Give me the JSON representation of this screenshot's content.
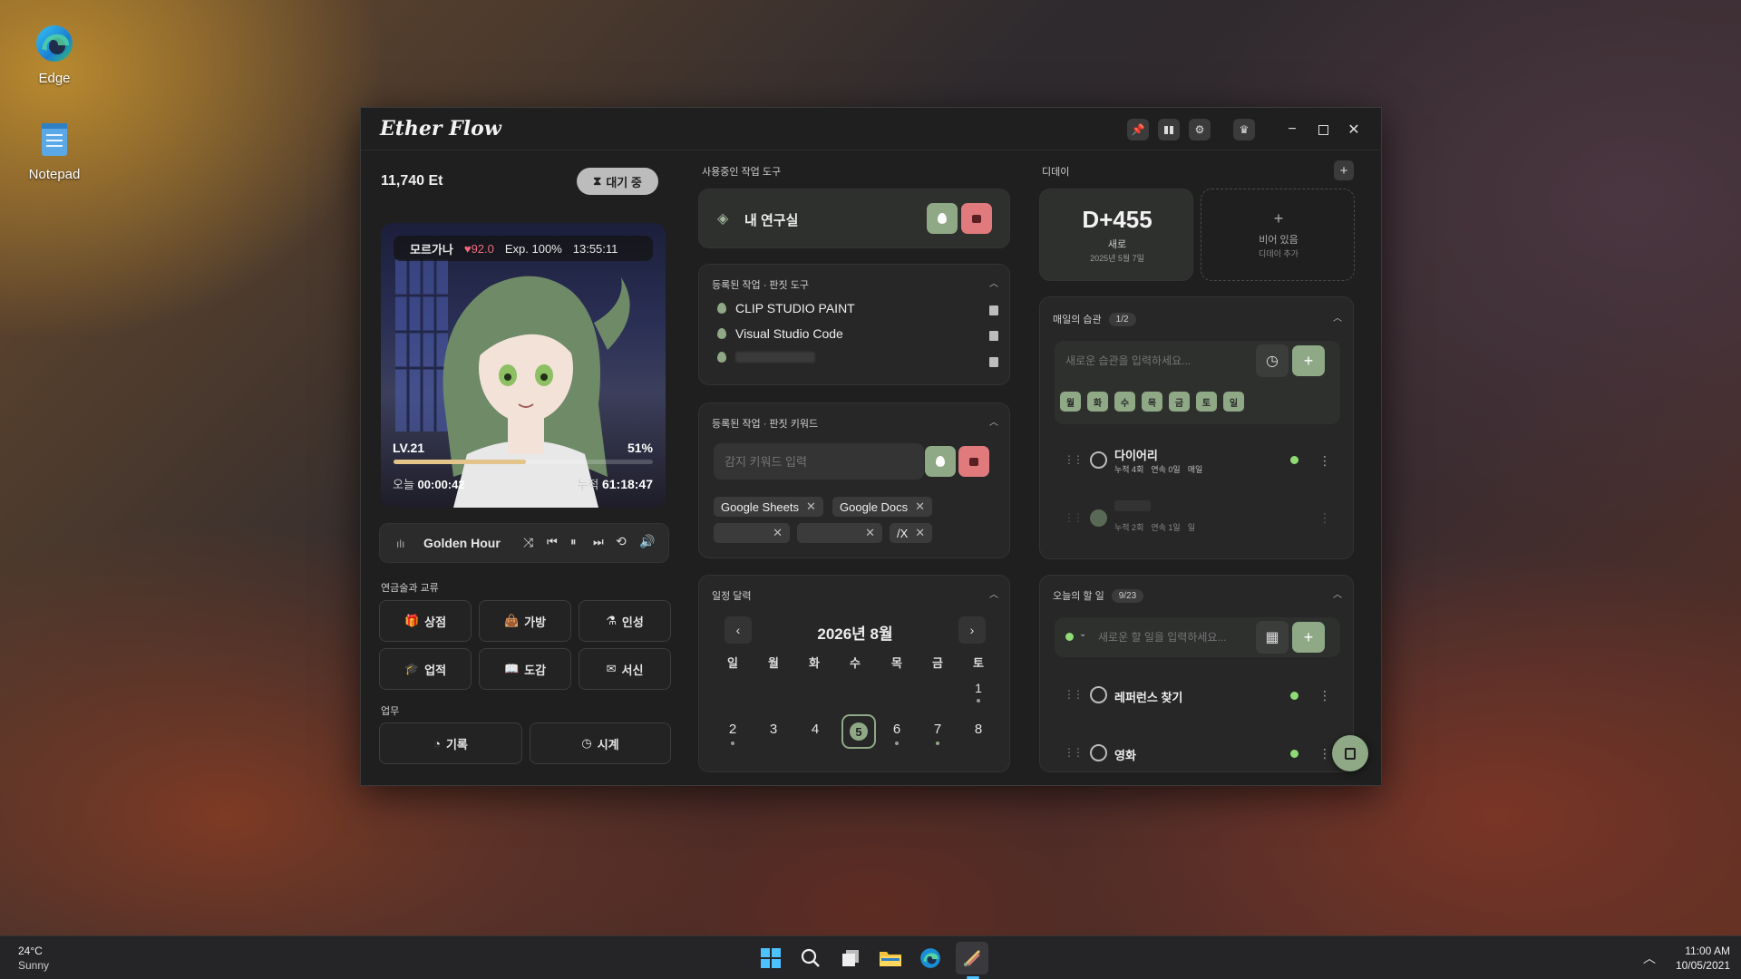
{
  "desktop": {
    "icons": [
      {
        "label": "Edge",
        "icon": "edge-icon"
      },
      {
        "label": "Notepad",
        "icon": "notepad-icon"
      }
    ]
  },
  "window": {
    "title": "Ether Flow",
    "toolbar_icons": [
      "pin-icon",
      "columns-icon",
      "settings-icon",
      "crown-icon",
      "minimize-icon",
      "maximize-icon",
      "close-icon"
    ]
  },
  "left": {
    "currency": "11,740 Et",
    "status_button": "대기 중",
    "character": {
      "name": "모르가나",
      "affection": "92.0",
      "exp": "Exp. 100%",
      "time": "13:55:11",
      "level": "LV.21",
      "level_percent": "51%",
      "level_progress": 0.51,
      "today_label": "오늘",
      "today_time": "00:00:42",
      "total_label": "누적",
      "total_time": "61:18:47"
    },
    "player": {
      "track": "Golden Hour"
    },
    "section_growth": "연금술과 교류",
    "growth_buttons": [
      "상점",
      "가방",
      "인성",
      "업적",
      "도감",
      "서신"
    ],
    "section_work": "업무",
    "work_buttons": [
      "기록",
      "시계"
    ]
  },
  "middle": {
    "active_tool_title": "사용중인 작업 도구",
    "active_tool": "내 연구실",
    "tools_title": "등록된 작업 · 판짓 도구",
    "tools": [
      "CLIP STUDIO PAINT",
      "Visual Studio Code",
      ""
    ],
    "keywords_title": "등록된 작업 · 판짓 키워드",
    "keyword_placeholder": "감지 키워드 입력",
    "keywords": [
      "Google Sheets",
      "Google Docs",
      "",
      "",
      "/X"
    ],
    "calendar_title": "일정 달력",
    "calendar_month": "2026년 8월",
    "weekdays": [
      "일",
      "월",
      "화",
      "수",
      "목",
      "금",
      "토"
    ],
    "week1": [
      "",
      "",
      "",
      "",
      "",
      "",
      "1"
    ],
    "week2": [
      "2",
      "3",
      "4",
      "5",
      "6",
      "7",
      "8"
    ],
    "selected_day": "5"
  },
  "right": {
    "dday_title": "디데이",
    "dday": {
      "value": "D+455",
      "label": "새로",
      "date": "2025년 5월 7일"
    },
    "dday_empty": {
      "title": "비어 있음",
      "sub": "디데이 추가"
    },
    "habits_title": "매일의 습관",
    "habits_count": "1/2",
    "habit_placeholder": "새로운 습관을 입력하세요...",
    "habit_days": [
      "월",
      "화",
      "수",
      "목",
      "금",
      "토",
      "일"
    ],
    "habits": [
      {
        "name": "다이어리",
        "total": "누적 4회",
        "streak": "연속 0일",
        "freq": "매일",
        "done": false
      },
      {
        "name": "",
        "total": "누적 2회",
        "streak": "연속 1일",
        "freq": "일",
        "done": true
      }
    ],
    "todos_title": "오늘의 할 일",
    "todos_count": "9/23",
    "todo_placeholder": "새로운 할 일을 입력하세요...",
    "todos": [
      "레퍼런스 찾기",
      "영화"
    ]
  },
  "taskbar": {
    "weather_temp": "24°C",
    "weather_desc": "Sunny",
    "time": "11:00 AM",
    "date": "10/05/2021"
  },
  "colors": {
    "accent_green": "#8fa886",
    "accent_red": "#e07a7c",
    "panel": "#262726",
    "bg": "#1e1f1e"
  }
}
